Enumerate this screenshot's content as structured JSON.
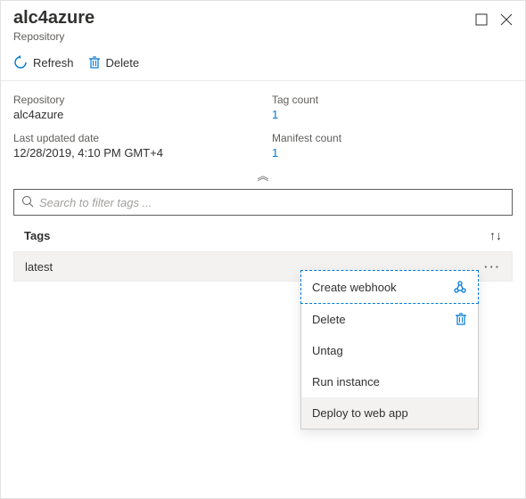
{
  "header": {
    "title": "alc4azure",
    "subtitle": "Repository"
  },
  "toolbar": {
    "refresh_label": "Refresh",
    "delete_label": "Delete"
  },
  "meta": {
    "repository_label": "Repository",
    "repository_value": "alc4azure",
    "tag_count_label": "Tag count",
    "tag_count_value": "1",
    "updated_label": "Last updated date",
    "updated_value": "12/28/2019, 4:10 PM GMT+4",
    "manifest_count_label": "Manifest count",
    "manifest_count_value": "1"
  },
  "search": {
    "placeholder": "Search to filter tags ..."
  },
  "tags": {
    "header_label": "Tags",
    "items": [
      {
        "name": "latest"
      }
    ]
  },
  "context_menu": {
    "items": [
      {
        "label": "Create webhook"
      },
      {
        "label": "Delete"
      },
      {
        "label": "Untag"
      },
      {
        "label": "Run instance"
      },
      {
        "label": "Deploy to web app"
      }
    ]
  }
}
